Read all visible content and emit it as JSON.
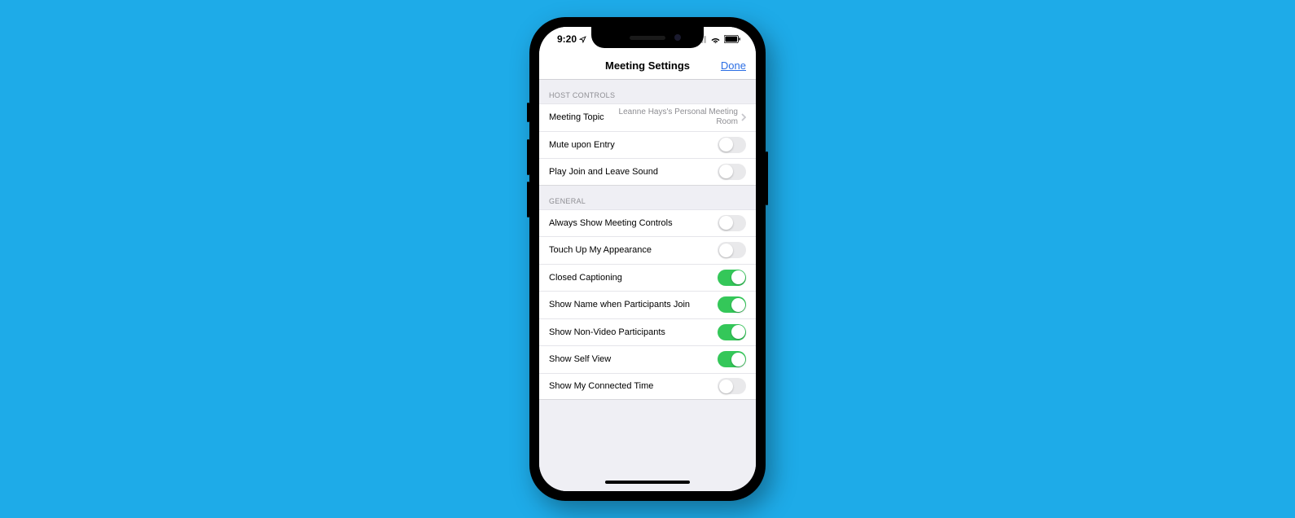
{
  "status": {
    "time": "9:20"
  },
  "nav": {
    "title": "Meeting Settings",
    "done": "Done"
  },
  "sections": {
    "host": {
      "header": "HOST CONTROLS",
      "topic_label": "Meeting Topic",
      "topic_value": "Leanne Hays's Personal Meeting Room",
      "mute_label": "Mute upon Entry",
      "sound_label": "Play Join and Leave Sound"
    },
    "general": {
      "header": "GENERAL",
      "controls_label": "Always Show Meeting Controls",
      "touchup_label": "Touch Up My Appearance",
      "caption_label": "Closed Captioning",
      "showname_label": "Show Name when Participants Join",
      "nonvideo_label": "Show Non-Video Participants",
      "selfview_label": "Show Self View",
      "connected_label": "Show My Connected Time"
    }
  },
  "toggles": {
    "mute": false,
    "sound": false,
    "controls": false,
    "touchup": false,
    "caption": true,
    "showname": true,
    "nonvideo": true,
    "selfview": true,
    "connected": false
  }
}
